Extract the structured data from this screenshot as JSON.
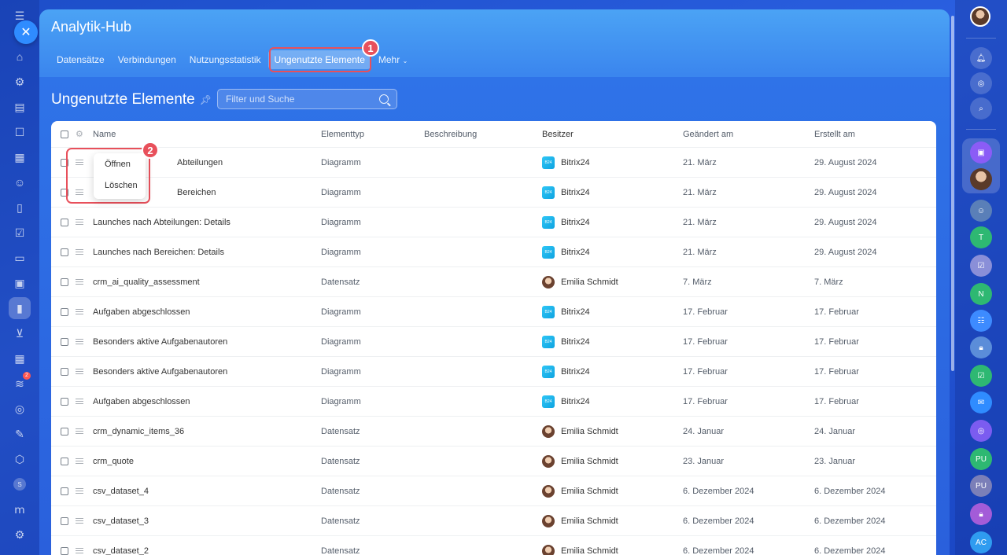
{
  "app": {
    "title": "Analytik-Hub",
    "tabs": [
      {
        "label": "Datensätze"
      },
      {
        "label": "Verbindungen"
      },
      {
        "label": "Nutzungsstatistik"
      },
      {
        "label": "Ungenutzte Elemente"
      },
      {
        "label": "Mehr"
      }
    ],
    "active_tab": "Ungenutzte Elemente"
  },
  "page": {
    "title": "Ungenutzte Elemente",
    "search_placeholder": "Filter und Suche"
  },
  "callouts": {
    "one": "1",
    "two": "2"
  },
  "context_menu": {
    "open_label": "Öffnen",
    "delete_label": "Löschen"
  },
  "table": {
    "headers": {
      "name": "Name",
      "type": "Elementtyp",
      "description": "Beschreibung",
      "owner": "Besitzer",
      "changed": "Geändert am",
      "created": "Erstellt am"
    },
    "rows": [
      {
        "name": "Abteilungen",
        "type": "Diagramm",
        "owner": "Bitrix24",
        "owner_kind": "bitrix",
        "changed": "21. März",
        "created": "29. August 2024"
      },
      {
        "name": "Bereichen",
        "type": "Diagramm",
        "owner": "Bitrix24",
        "owner_kind": "bitrix",
        "changed": "21. März",
        "created": "29. August 2024"
      },
      {
        "name": "Launches nach Abteilungen: Details",
        "type": "Diagramm",
        "owner": "Bitrix24",
        "owner_kind": "bitrix",
        "changed": "21. März",
        "created": "29. August 2024"
      },
      {
        "name": "Launches nach Bereichen: Details",
        "type": "Diagramm",
        "owner": "Bitrix24",
        "owner_kind": "bitrix",
        "changed": "21. März",
        "created": "29. August 2024"
      },
      {
        "name": "crm_ai_quality_assessment",
        "type": "Datensatz",
        "owner": "Emilia Schmidt",
        "owner_kind": "person",
        "changed": "7. März",
        "created": "7. März"
      },
      {
        "name": "Aufgaben abgeschlossen",
        "type": "Diagramm",
        "owner": "Bitrix24",
        "owner_kind": "bitrix",
        "changed": "17. Februar",
        "created": "17. Februar"
      },
      {
        "name": "Besonders aktive Aufgabenautoren",
        "type": "Diagramm",
        "owner": "Bitrix24",
        "owner_kind": "bitrix",
        "changed": "17. Februar",
        "created": "17. Februar"
      },
      {
        "name": "Besonders aktive Aufgabenautoren",
        "type": "Diagramm",
        "owner": "Bitrix24",
        "owner_kind": "bitrix",
        "changed": "17. Februar",
        "created": "17. Februar"
      },
      {
        "name": "Aufgaben abgeschlossen",
        "type": "Diagramm",
        "owner": "Bitrix24",
        "owner_kind": "bitrix",
        "changed": "17. Februar",
        "created": "17. Februar"
      },
      {
        "name": "crm_dynamic_items_36",
        "type": "Datensatz",
        "owner": "Emilia Schmidt",
        "owner_kind": "person",
        "changed": "24. Januar",
        "created": "24. Januar"
      },
      {
        "name": "crm_quote",
        "type": "Datensatz",
        "owner": "Emilia Schmidt",
        "owner_kind": "person",
        "changed": "23. Januar",
        "created": "23. Januar"
      },
      {
        "name": "csv_dataset_4",
        "type": "Datensatz",
        "owner": "Emilia Schmidt",
        "owner_kind": "person",
        "changed": "6. Dezember 2024",
        "created": "6. Dezember 2024"
      },
      {
        "name": "csv_dataset_3",
        "type": "Datensatz",
        "owner": "Emilia Schmidt",
        "owner_kind": "person",
        "changed": "6. Dezember 2024",
        "created": "6. Dezember 2024"
      },
      {
        "name": "csv_dataset_2",
        "type": "Datensatz",
        "owner": "Emilia Schmidt",
        "owner_kind": "person",
        "changed": "6. Dezember 2024",
        "created": "6. Dezember 2024"
      }
    ]
  },
  "left_rail": {
    "badge_count": "2",
    "status_letter": "S"
  },
  "right_rail": {
    "initials": [
      "T",
      "N",
      "PU",
      "PU",
      "AC"
    ]
  },
  "colors": {
    "accent_red": "#e8505b",
    "bitrix_blue": "#2fc6f6"
  }
}
